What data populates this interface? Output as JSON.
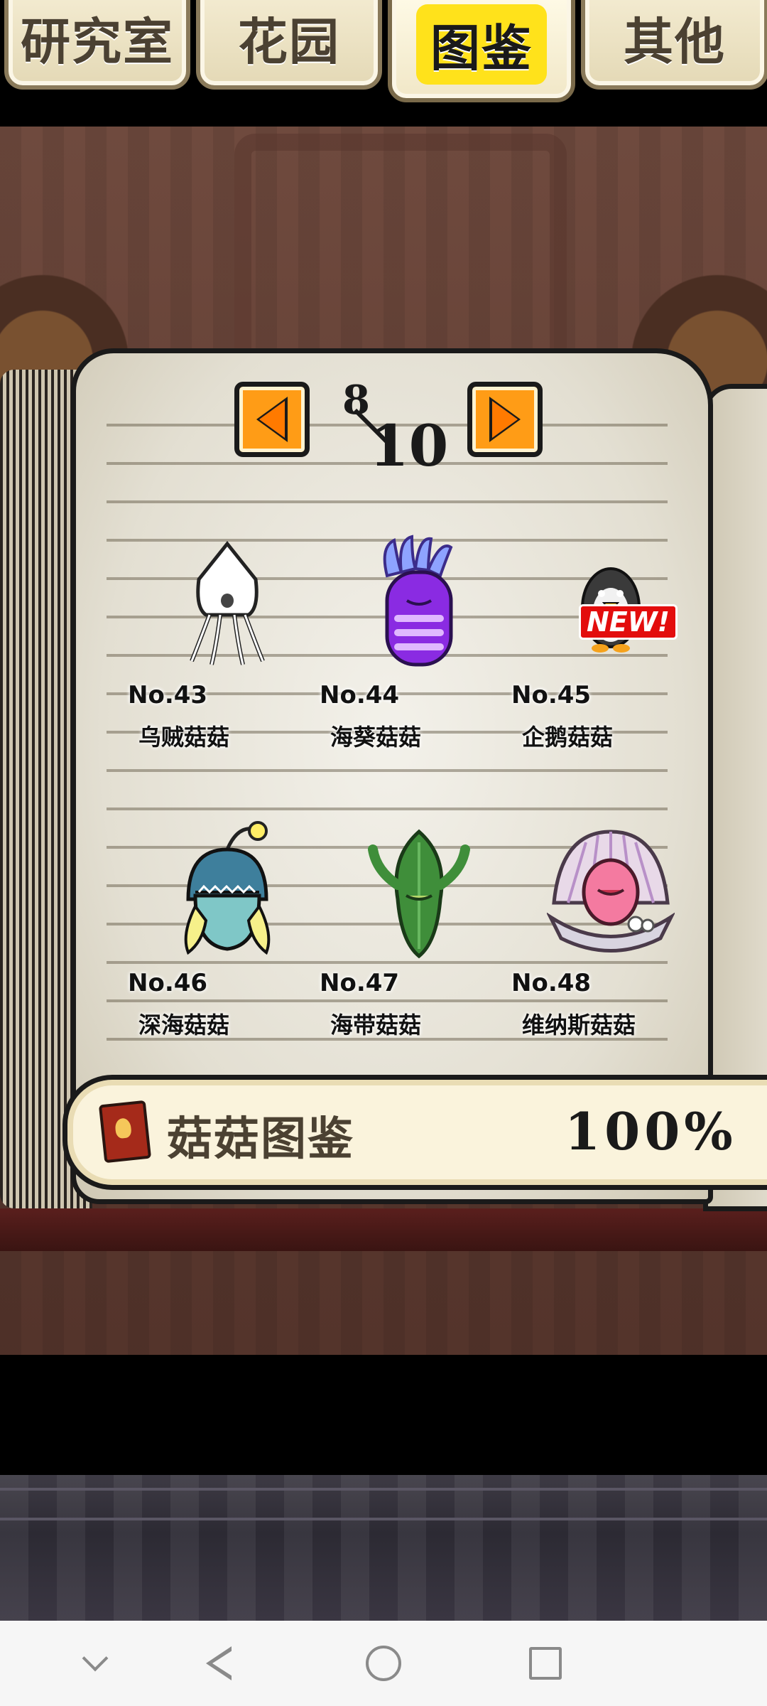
{
  "tabs": [
    {
      "label": "研究室",
      "active": false
    },
    {
      "label": "花园",
      "active": false
    },
    {
      "label": "图鉴",
      "active": true
    },
    {
      "label": "其他",
      "active": false
    }
  ],
  "pager": {
    "current": "8",
    "total": "10"
  },
  "entries": [
    {
      "no": "No.43",
      "name": "乌贼菇菇",
      "icon": "squid-mushroom-icon",
      "is_new": false
    },
    {
      "no": "No.44",
      "name": "海葵菇菇",
      "icon": "anemone-mushroom-icon",
      "is_new": false
    },
    {
      "no": "No.45",
      "name": "企鹅菇菇",
      "icon": "penguin-mushroom-icon",
      "is_new": true,
      "badge": "NEW!"
    },
    {
      "no": "No.46",
      "name": "深海菇菇",
      "icon": "anglerfish-mushroom-icon",
      "is_new": false
    },
    {
      "no": "No.47",
      "name": "海带菇菇",
      "icon": "kelp-mushroom-icon",
      "is_new": false
    },
    {
      "no": "No.48",
      "name": "维纳斯菇菇",
      "icon": "venus-shell-mushroom-icon",
      "is_new": false
    }
  ],
  "progress": {
    "label": "菇菇图鉴",
    "percent": "100",
    "unit": "%"
  },
  "colors": {
    "accent_orange": "#ff9c16",
    "tab_highlight": "#ffe21b",
    "new_badge": "#e30d0d",
    "book_cover": "#5a1f1d"
  }
}
